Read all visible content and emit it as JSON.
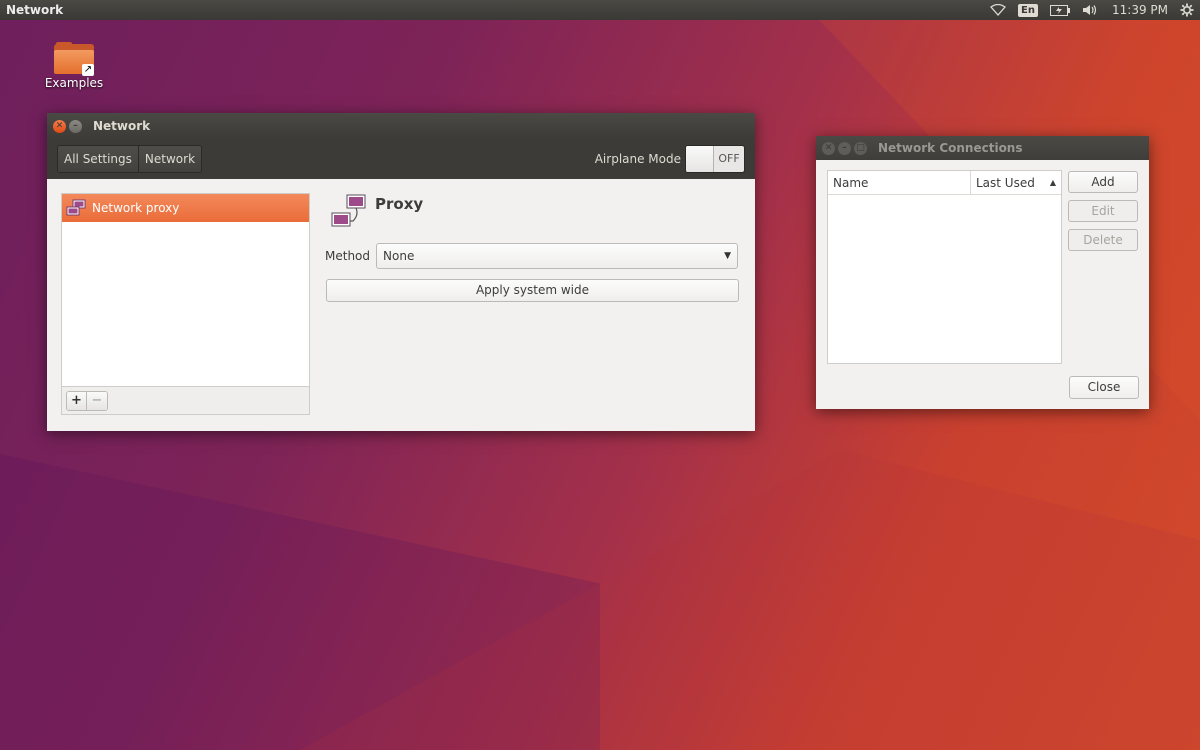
{
  "top_panel": {
    "title": "Network",
    "language": "En",
    "clock": "11:39 PM",
    "icons": [
      "wifi-icon",
      "battery-icon",
      "volume-icon",
      "gear-icon"
    ]
  },
  "desktop": {
    "items": [
      {
        "label": "Examples",
        "icon": "folder-icon"
      }
    ]
  },
  "network_window": {
    "title": "Network",
    "breadcrumbs": [
      "All Settings",
      "Network"
    ],
    "airplane_mode": {
      "label": "Airplane Mode",
      "state": "OFF"
    },
    "list": {
      "items": [
        {
          "label": "Network proxy",
          "selected": true
        }
      ],
      "add": "+",
      "remove": "−"
    },
    "proxy": {
      "title": "Proxy",
      "method_label": "Method",
      "method_value": "None",
      "apply_label": "Apply system wide"
    }
  },
  "connections_window": {
    "title": "Network Connections",
    "columns": [
      "Name",
      "Last Used"
    ],
    "buttons": {
      "add": "Add",
      "edit": "Edit",
      "delete": "Delete",
      "close": "Close"
    }
  },
  "colors": {
    "accent": "#ea6d3a",
    "panel": "#3c3b37",
    "window_bg": "#f2f1f0"
  }
}
